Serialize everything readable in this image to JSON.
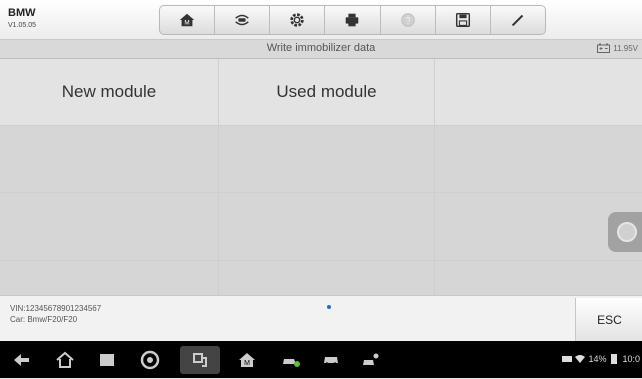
{
  "app": {
    "name": "BMW",
    "version": "V1.05.05"
  },
  "toolbar": {
    "buttons": [
      {
        "icon": "home-icon"
      },
      {
        "icon": "vehicle-swap-icon"
      },
      {
        "icon": "settings-gear-icon"
      },
      {
        "icon": "printer-icon"
      },
      {
        "icon": "help-icon"
      },
      {
        "icon": "save-icon"
      },
      {
        "icon": "pen-icon"
      }
    ]
  },
  "titlebar": {
    "title": "Write immobilizer data",
    "voltage": "11.95V"
  },
  "grid": {
    "cells": [
      "New module",
      "Used module",
      "",
      "",
      "",
      "",
      "",
      "",
      "",
      "",
      "",
      ""
    ]
  },
  "vehicle": {
    "vin": "VIN:12345678901234567",
    "car": "Car: Bmw/F20/F20"
  },
  "actions": {
    "esc_label": "ESC"
  },
  "status": {
    "battery": "14%",
    "time": "10:0"
  },
  "colors": {
    "page_indicator": "#1e6fd0",
    "navbar": "#000000"
  }
}
